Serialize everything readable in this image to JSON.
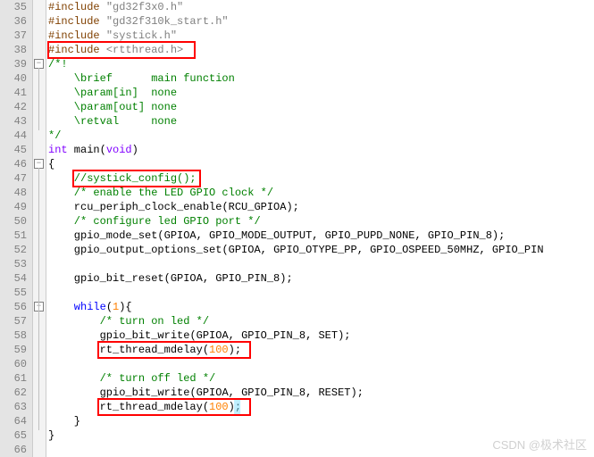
{
  "lines": [
    {
      "num": 35,
      "segments": [
        {
          "t": "#include ",
          "cls": "c-preproc"
        },
        {
          "t": "\"gd32f3x0.h\"",
          "cls": "c-string"
        }
      ]
    },
    {
      "num": 36,
      "segments": [
        {
          "t": "#include ",
          "cls": "c-preproc"
        },
        {
          "t": "\"gd32f310k_start.h\"",
          "cls": "c-string"
        }
      ]
    },
    {
      "num": 37,
      "segments": [
        {
          "t": "#include ",
          "cls": "c-preproc"
        },
        {
          "t": "\"systick.h\"",
          "cls": "c-string"
        }
      ]
    },
    {
      "num": 38,
      "segments": [
        {
          "t": "#include ",
          "cls": "c-preproc"
        },
        {
          "t": "<rtthread.h>",
          "cls": "c-string"
        }
      ]
    },
    {
      "num": 39,
      "fold": "minus",
      "segments": [
        {
          "t": "/*!",
          "cls": "c-comment"
        }
      ]
    },
    {
      "num": 40,
      "segments": [
        {
          "t": "    \\brief      main function",
          "cls": "c-comment"
        }
      ]
    },
    {
      "num": 41,
      "segments": [
        {
          "t": "    \\param[in]  none",
          "cls": "c-comment"
        }
      ]
    },
    {
      "num": 42,
      "segments": [
        {
          "t": "    \\param[out] none",
          "cls": "c-comment"
        }
      ]
    },
    {
      "num": 43,
      "segments": [
        {
          "t": "    \\retval     none",
          "cls": "c-comment"
        }
      ]
    },
    {
      "num": 44,
      "segments": [
        {
          "t": "*/",
          "cls": "c-comment"
        }
      ]
    },
    {
      "num": 45,
      "segments": [
        {
          "t": "int",
          "cls": "c-type"
        },
        {
          "t": " main",
          "cls": "c-ident"
        },
        {
          "t": "(",
          "cls": "c-ident"
        },
        {
          "t": "void",
          "cls": "c-type"
        },
        {
          "t": ")",
          "cls": "c-ident"
        }
      ]
    },
    {
      "num": 46,
      "fold": "minus",
      "segments": [
        {
          "t": "{",
          "cls": "c-ident"
        }
      ]
    },
    {
      "num": 47,
      "segments": [
        {
          "t": "    //systick_config();",
          "cls": "c-comment"
        }
      ]
    },
    {
      "num": 48,
      "segments": [
        {
          "t": "    /* enable the LED GPIO clock */",
          "cls": "c-comment"
        }
      ]
    },
    {
      "num": 49,
      "segments": [
        {
          "t": "    rcu_periph_clock_enable",
          "cls": "c-ident"
        },
        {
          "t": "(",
          "cls": "c-ident"
        },
        {
          "t": "RCU_GPIOA",
          "cls": "c-ident"
        },
        {
          "t": ");",
          "cls": "c-ident"
        }
      ]
    },
    {
      "num": 50,
      "segments": [
        {
          "t": "    /* configure led GPIO port */",
          "cls": "c-comment"
        }
      ]
    },
    {
      "num": 51,
      "segments": [
        {
          "t": "    gpio_mode_set",
          "cls": "c-ident"
        },
        {
          "t": "(",
          "cls": "c-ident"
        },
        {
          "t": "GPIOA",
          "cls": "c-ident"
        },
        {
          "t": ", ",
          "cls": "c-ident"
        },
        {
          "t": "GPIO_MODE_OUTPUT",
          "cls": "c-ident"
        },
        {
          "t": ", ",
          "cls": "c-ident"
        },
        {
          "t": "GPIO_PUPD_NONE",
          "cls": "c-ident"
        },
        {
          "t": ", ",
          "cls": "c-ident"
        },
        {
          "t": "GPIO_PIN_8",
          "cls": "c-ident"
        },
        {
          "t": ");",
          "cls": "c-ident"
        }
      ]
    },
    {
      "num": 52,
      "segments": [
        {
          "t": "    gpio_output_options_set",
          "cls": "c-ident"
        },
        {
          "t": "(",
          "cls": "c-ident"
        },
        {
          "t": "GPIOA",
          "cls": "c-ident"
        },
        {
          "t": ", ",
          "cls": "c-ident"
        },
        {
          "t": "GPIO_OTYPE_PP",
          "cls": "c-ident"
        },
        {
          "t": ", ",
          "cls": "c-ident"
        },
        {
          "t": "GPIO_OSPEED_50MHZ",
          "cls": "c-ident"
        },
        {
          "t": ", ",
          "cls": "c-ident"
        },
        {
          "t": "GPIO_PIN",
          "cls": "c-ident"
        }
      ]
    },
    {
      "num": 53,
      "segments": [
        {
          "t": "",
          "cls": "c-ident"
        }
      ]
    },
    {
      "num": 54,
      "segments": [
        {
          "t": "    gpio_bit_reset",
          "cls": "c-ident"
        },
        {
          "t": "(",
          "cls": "c-ident"
        },
        {
          "t": "GPIOA",
          "cls": "c-ident"
        },
        {
          "t": ", ",
          "cls": "c-ident"
        },
        {
          "t": "GPIO_PIN_8",
          "cls": "c-ident"
        },
        {
          "t": ");",
          "cls": "c-ident"
        }
      ]
    },
    {
      "num": 55,
      "segments": [
        {
          "t": "",
          "cls": "c-ident"
        }
      ]
    },
    {
      "num": 56,
      "fold": "minus",
      "segments": [
        {
          "t": "    while",
          "cls": "c-keyword"
        },
        {
          "t": "(",
          "cls": "c-ident"
        },
        {
          "t": "1",
          "cls": "c-number"
        },
        {
          "t": "){",
          "cls": "c-ident"
        }
      ]
    },
    {
      "num": 57,
      "segments": [
        {
          "t": "        /* turn on led */",
          "cls": "c-comment"
        }
      ]
    },
    {
      "num": 58,
      "segments": [
        {
          "t": "        gpio_bit_write",
          "cls": "c-ident"
        },
        {
          "t": "(",
          "cls": "c-ident"
        },
        {
          "t": "GPIOA",
          "cls": "c-ident"
        },
        {
          "t": ", ",
          "cls": "c-ident"
        },
        {
          "t": "GPIO_PIN_8",
          "cls": "c-ident"
        },
        {
          "t": ", ",
          "cls": "c-ident"
        },
        {
          "t": "SET",
          "cls": "c-ident"
        },
        {
          "t": ");",
          "cls": "c-ident"
        }
      ]
    },
    {
      "num": 59,
      "segments": [
        {
          "t": "        rt_thread_mdelay",
          "cls": "c-ident"
        },
        {
          "t": "(",
          "cls": "c-ident"
        },
        {
          "t": "100",
          "cls": "c-number"
        },
        {
          "t": ");",
          "cls": "c-ident"
        }
      ]
    },
    {
      "num": 60,
      "segments": [
        {
          "t": "",
          "cls": "c-ident"
        }
      ]
    },
    {
      "num": 61,
      "segments": [
        {
          "t": "        /* turn off led */",
          "cls": "c-comment"
        }
      ]
    },
    {
      "num": 62,
      "segments": [
        {
          "t": "        gpio_bit_write",
          "cls": "c-ident"
        },
        {
          "t": "(",
          "cls": "c-ident"
        },
        {
          "t": "GPIOA",
          "cls": "c-ident"
        },
        {
          "t": ", ",
          "cls": "c-ident"
        },
        {
          "t": "GPIO_PIN_8",
          "cls": "c-ident"
        },
        {
          "t": ", ",
          "cls": "c-ident"
        },
        {
          "t": "RESET",
          "cls": "c-ident"
        },
        {
          "t": ");",
          "cls": "c-ident"
        }
      ]
    },
    {
      "num": 63,
      "segments": [
        {
          "t": "        rt_thread_mdelay",
          "cls": "c-ident"
        },
        {
          "t": "(",
          "cls": "c-ident"
        },
        {
          "t": "100",
          "cls": "c-number"
        },
        {
          "t": ")",
          "cls": "c-ident"
        },
        {
          "t": ";",
          "cls": "c-ident"
        }
      ]
    },
    {
      "num": 64,
      "segments": [
        {
          "t": "    }",
          "cls": "c-ident"
        }
      ]
    },
    {
      "num": 65,
      "segments": [
        {
          "t": "}",
          "cls": "c-ident"
        }
      ]
    },
    {
      "num": 66,
      "segments": [
        {
          "t": "",
          "cls": "c-ident"
        }
      ]
    }
  ],
  "highlights": [
    {
      "lineIndex": 3,
      "x": 0,
      "w": 164
    },
    {
      "lineIndex": 12,
      "x": 28,
      "w": 142
    },
    {
      "lineIndex": 24,
      "x": 56,
      "w": 170
    },
    {
      "lineIndex": 28,
      "x": 56,
      "w": 170
    }
  ],
  "cursor": {
    "lineIndex": 28,
    "deltaX": 169
  },
  "watermark": "CSDN @极术社区"
}
